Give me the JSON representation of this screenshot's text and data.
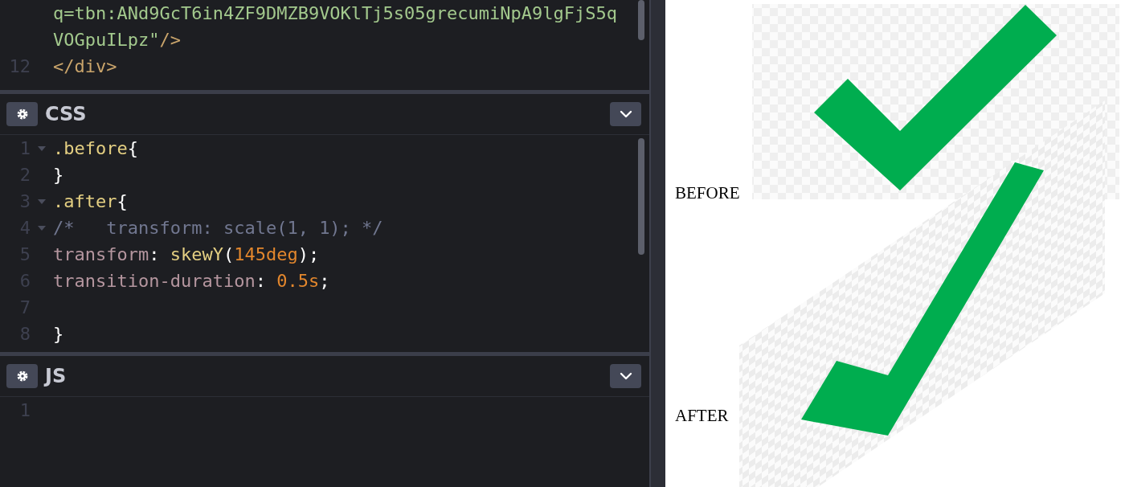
{
  "editors": [
    {
      "lines": [
        {
          "tokens": [
            {
              "kind": "string",
              "text": "q=tbn:ANd9GcT6in4ZF9DMZB9VOKlTj5s05grecumiNpA9lgFjS5q"
            }
          ]
        },
        {
          "tokens": [
            {
              "kind": "string",
              "text": "VOGpuILpz\""
            },
            {
              "kind": "tag",
              "text": "/>"
            }
          ]
        },
        {
          "number": "12",
          "tokens": [
            {
              "kind": "tag",
              "text": "</div>"
            }
          ]
        }
      ]
    },
    {
      "title": "CSS",
      "lines": [
        {
          "number": "1",
          "fold": true,
          "tokens": [
            {
              "kind": "selector",
              "text": ".before"
            },
            {
              "kind": "punct",
              "text": "{"
            }
          ]
        },
        {
          "number": "2",
          "tokens": [
            {
              "kind": "punct",
              "text": "}"
            }
          ]
        },
        {
          "number": "3",
          "fold": true,
          "tokens": [
            {
              "kind": "selector",
              "text": ".after"
            },
            {
              "kind": "punct",
              "text": "{"
            }
          ]
        },
        {
          "number": "4",
          "fold": true,
          "tokens": [
            {
              "kind": "comment",
              "text": "/*   transform: scale(1, 1); */"
            }
          ]
        },
        {
          "number": "5",
          "tokens": [
            {
              "kind": "property",
              "text": "transform"
            },
            {
              "kind": "punct",
              "text": ": "
            },
            {
              "kind": "function",
              "text": "skewY"
            },
            {
              "kind": "punct",
              "text": "("
            },
            {
              "kind": "number",
              "text": "145deg"
            },
            {
              "kind": "punct",
              "text": ");"
            }
          ]
        },
        {
          "number": "6",
          "tokens": [
            {
              "kind": "property",
              "text": "transition-duration"
            },
            {
              "kind": "punct",
              "text": ": "
            },
            {
              "kind": "number",
              "text": "0.5s"
            },
            {
              "kind": "punct",
              "text": ";"
            }
          ]
        },
        {
          "number": "7"
        },
        {
          "number": "8",
          "tokens": [
            {
              "kind": "punct",
              "text": "}"
            }
          ]
        }
      ]
    },
    {
      "title": "JS",
      "lines": [
        {
          "number": "1"
        }
      ]
    }
  ],
  "output": {
    "before_label": "BEFORE",
    "after_label": "AFTER"
  }
}
